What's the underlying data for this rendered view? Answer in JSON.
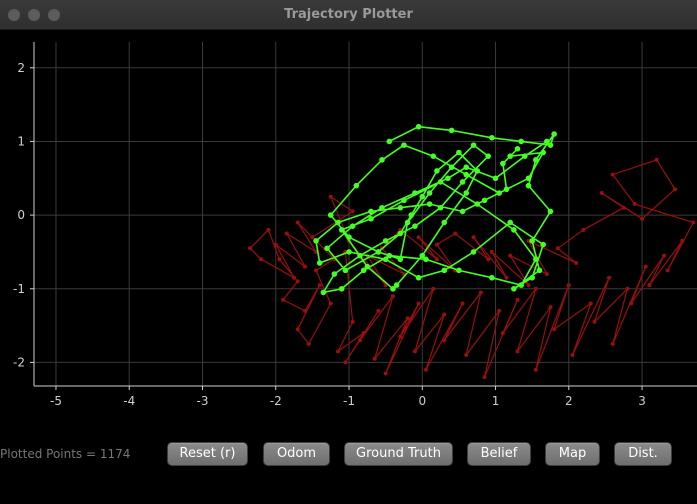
{
  "window": {
    "title": "Trajectory Plotter"
  },
  "status": {
    "plotted_points": "Plotted Points = 1174"
  },
  "buttons": {
    "reset": "Reset (r)",
    "odom": "Odom",
    "ground_truth": "Ground Truth",
    "belief": "Belief",
    "map": "Map",
    "dist": "Dist."
  },
  "colors": {
    "background": "#000000",
    "grid": "#3a3a3a",
    "axis": "#cfcfcf",
    "belief": "#44ff22",
    "odom": "#9a0e0e"
  },
  "chart_data": {
    "type": "scatter",
    "title": "",
    "xlabel": "",
    "ylabel": "",
    "xlim": [
      -5.3,
      3.75
    ],
    "ylim": [
      -2.32,
      2.35
    ],
    "x_ticks": [
      -5,
      -4,
      -3,
      -2,
      -1,
      0,
      1,
      2,
      3
    ],
    "y_ticks": [
      -2,
      -1,
      0,
      1,
      2
    ],
    "grid": true,
    "series": [
      {
        "color": "#9a0e0e",
        "x": [
          -2.35,
          -2.1,
          -1.95,
          -1.7,
          -1.9,
          -1.6,
          -1.4,
          -1.7,
          -1.55,
          -1.25,
          -1.45,
          -1.05,
          -0.95,
          -1.15,
          -0.8,
          -1.05,
          -0.6,
          -0.85,
          -0.4,
          -0.65,
          -0.2,
          -0.5,
          -0.05,
          -0.3,
          0.15,
          -0.1,
          0.3,
          0.05,
          0.55,
          0.3,
          0.8,
          0.6,
          1.05,
          0.85,
          1.3,
          1.1,
          1.55,
          1.3,
          1.75,
          1.55,
          2.0,
          1.8,
          2.3,
          2.05,
          2.55,
          2.35,
          2.8,
          2.6,
          3.05,
          2.85,
          3.3,
          3.1,
          3.55,
          3.35,
          3.7,
          2.9,
          2.6,
          3.2,
          3.45,
          3.0,
          2.45,
          2.75,
          2.2,
          1.85,
          2.1,
          1.45,
          1.7,
          1.2,
          1.45,
          0.95,
          1.15,
          0.7,
          0.9,
          0.45,
          0.2,
          0.45,
          -0.05,
          0.2,
          -0.3,
          -0.55,
          -0.25,
          -0.75,
          -0.5,
          -1.0,
          -1.25,
          -0.95,
          -1.5,
          -1.2,
          -1.7,
          -1.45,
          -1.85,
          -1.6,
          -2.0,
          -1.75,
          -2.2,
          -2.35
        ],
        "y": [
          -0.45,
          -0.2,
          -0.6,
          -0.9,
          -1.15,
          -1.3,
          -0.95,
          -1.55,
          -1.75,
          -1.2,
          -0.75,
          -0.5,
          -1.45,
          -1.85,
          -1.6,
          -2.0,
          -1.3,
          -1.7,
          -1.1,
          -1.95,
          -1.4,
          -2.15,
          -1.2,
          -1.65,
          -1.0,
          -1.85,
          -1.35,
          -2.1,
          -1.2,
          -1.7,
          -1.05,
          -1.9,
          -1.3,
          -2.2,
          -1.15,
          -1.6,
          -1.0,
          -1.85,
          -1.25,
          -2.1,
          -0.95,
          -1.55,
          -1.2,
          -1.9,
          -0.85,
          -1.45,
          -1.0,
          -1.75,
          -0.7,
          -1.2,
          -0.55,
          -0.95,
          -0.35,
          -0.75,
          -0.1,
          0.15,
          0.55,
          0.75,
          0.35,
          -0.05,
          0.3,
          0.1,
          -0.2,
          -0.45,
          -0.65,
          -0.35,
          -0.8,
          -0.55,
          -0.95,
          -0.5,
          -0.85,
          -0.3,
          -0.6,
          -0.25,
          -0.4,
          -0.75,
          -0.3,
          -0.6,
          -0.2,
          -0.45,
          -0.8,
          -0.55,
          -0.95,
          -0.35,
          0.25,
          0.05,
          -0.3,
          -0.6,
          -0.1,
          -0.5,
          -0.25,
          -0.7,
          -0.4,
          -0.85,
          -0.6,
          -0.45
        ]
      },
      {
        "color": "#44ff22",
        "x": [
          -0.45,
          -0.05,
          0.4,
          0.95,
          1.35,
          1.75,
          1.8,
          1.55,
          1.45,
          1.75,
          1.5,
          1.6,
          1.25,
          1.5,
          1.65,
          1.2,
          0.7,
          0.3,
          -0.05,
          -0.5,
          -1.0,
          -1.4,
          -1.45,
          -1.15,
          -0.7,
          -0.3,
          0.1,
          0.55,
          0.85,
          1.15,
          1.1,
          1.3,
          1.2,
          1.65,
          1.45,
          1.05,
          0.6,
          0.15,
          -0.25,
          -0.55,
          -0.9,
          -1.25,
          -1.0,
          -0.6,
          -0.3,
          -0.2,
          0.1,
          0.4,
          0.7,
          0.9,
          0.55,
          0.25,
          -0.1,
          -0.5,
          -0.85,
          -1.2,
          -1.35,
          -1.1,
          -0.8,
          -0.45,
          0.05,
          0.5,
          0.95,
          1.35,
          1.55,
          1.25,
          0.75,
          0.25,
          -0.25,
          -0.7,
          -1.1,
          -0.75,
          -0.4,
          -0.35,
          0.0,
          0.3,
          0.6,
          0.75,
          0.5,
          0.2,
          0.0,
          -0.15,
          -0.3,
          -0.6,
          -1.05,
          -1.3,
          -0.95,
          -0.55,
          -0.1,
          0.35,
          0.6,
          1.0,
          1.4,
          1.7
        ],
        "y": [
          1.0,
          1.2,
          1.15,
          1.05,
          1.0,
          0.95,
          1.1,
          0.75,
          0.4,
          0.05,
          -0.35,
          -0.75,
          -1.0,
          -0.85,
          -0.4,
          -0.1,
          -0.5,
          -0.75,
          -0.85,
          -0.6,
          -0.5,
          -0.65,
          -0.35,
          -0.1,
          0.05,
          0.1,
          0.15,
          0.05,
          0.2,
          0.35,
          0.7,
          0.9,
          0.8,
          0.85,
          0.5,
          0.3,
          0.55,
          0.8,
          0.95,
          0.75,
          0.4,
          0.0,
          -0.3,
          -0.5,
          -0.6,
          -0.1,
          0.3,
          0.65,
          0.95,
          0.8,
          0.45,
          0.1,
          -0.15,
          -0.35,
          -0.55,
          -0.8,
          -1.05,
          -1.0,
          -0.75,
          -0.55,
          -0.6,
          -0.75,
          -0.85,
          -0.95,
          -0.6,
          -0.2,
          0.15,
          0.45,
          0.2,
          -0.05,
          -0.2,
          -0.7,
          -1.0,
          -0.95,
          -0.55,
          -0.1,
          0.3,
          0.6,
          0.85,
          0.6,
          0.25,
          0.0,
          -0.25,
          -0.5,
          -0.75,
          -0.45,
          -0.15,
          0.1,
          0.3,
          0.5,
          0.65,
          0.5,
          0.8,
          1.0
        ]
      }
    ]
  }
}
